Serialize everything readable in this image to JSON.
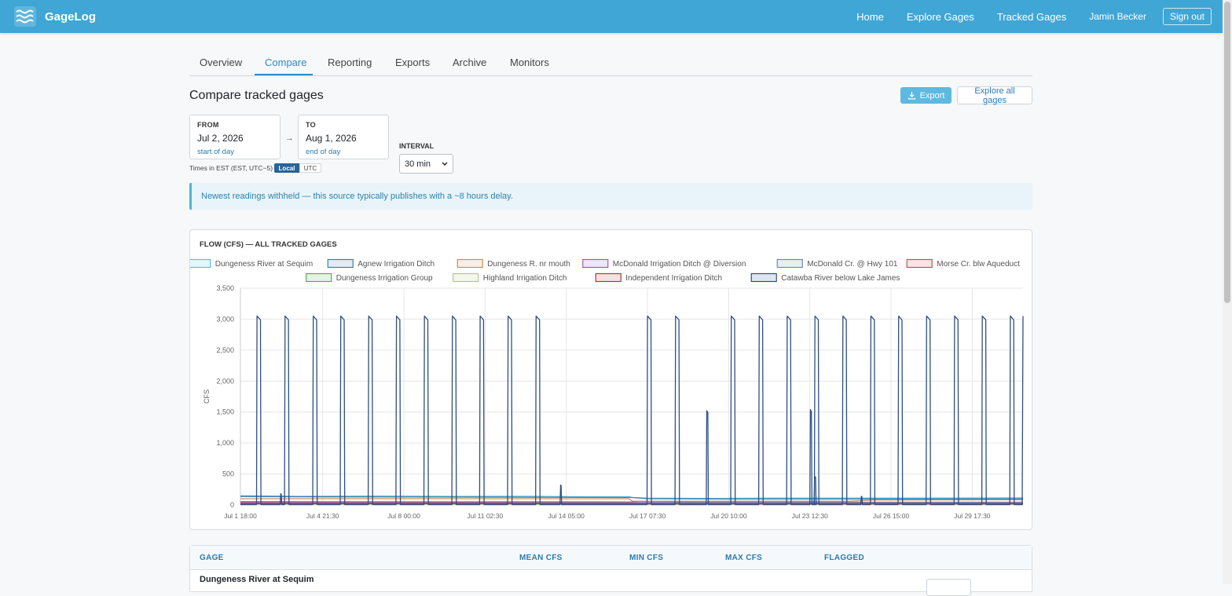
{
  "app": {
    "brand": "GageLog"
  },
  "nav": {
    "home": "Home",
    "explore": "Explore Gages",
    "tracked": "Tracked Gages",
    "user": "Jamin Becker",
    "signout": "Sign out"
  },
  "tabs": [
    {
      "label": "Overview"
    },
    {
      "label": "Compare"
    },
    {
      "label": "Reporting"
    },
    {
      "label": "Exports"
    },
    {
      "label": "Archive"
    },
    {
      "label": "Monitors"
    }
  ],
  "page": {
    "title": "Compare tracked gages",
    "export_label": "Export",
    "explore_all_label": "Explore all gages"
  },
  "range": {
    "from_label": "FROM",
    "from_value": "Jul 2, 2026",
    "from_sub": "start of day",
    "arrow": "→",
    "to_label": "TO",
    "to_value": "Aug 1, 2026",
    "to_sub": "end of day"
  },
  "interval": {
    "label": "INTERVAL",
    "value": "30 min"
  },
  "timezone": {
    "text": "Times in EST (EST, UTC−5)",
    "local": "Local",
    "utc": "UTC"
  },
  "notice": "Newest readings withheld — this source typically publishes with a ~8 hours delay.",
  "chart_data": {
    "type": "line",
    "title": "FLOW (CFS) — ALL TRACKED GAGES",
    "ylabel": "CFS",
    "xlabel": "",
    "ylim": [
      0,
      3500
    ],
    "xlim_days": [
      1.75,
      31.67
    ],
    "yticks": [
      0,
      500,
      1000,
      1500,
      2000,
      2500,
      3000,
      3500
    ],
    "ytick_labels": [
      "0",
      "500",
      "1,000",
      "1,500",
      "2,000",
      "2,500",
      "3,000",
      "3,500"
    ],
    "xtick_labels": [
      "Jul 1 18:00",
      "Jul 4 21:30",
      "Jul 8 00:00",
      "Jul 11 02:30",
      "Jul 14 05:00",
      "Jul 17 07:30",
      "Jul 20 10:00",
      "Jul 23 12:30",
      "Jul 26 15:00",
      "Jul 29 17:30"
    ],
    "xtick_days": [
      1.75,
      4.896,
      8.0,
      11.104,
      14.208,
      17.313,
      20.417,
      23.521,
      26.625,
      29.729
    ],
    "grid": true,
    "legend_position": "top",
    "series": [
      {
        "name": "Dungeness River at Sequim",
        "color": "#5cbfe8",
        "points": [
          [
            1.75,
            150
          ],
          [
            4,
            140
          ],
          [
            7,
            145
          ],
          [
            10,
            138
          ],
          [
            13,
            140
          ],
          [
            15,
            130
          ],
          [
            16.6,
            130
          ],
          [
            16.75,
            120
          ],
          [
            17.3,
            110
          ],
          [
            20,
            105
          ],
          [
            22,
            110
          ],
          [
            25,
            110
          ],
          [
            28,
            110
          ],
          [
            31.67,
            115
          ]
        ]
      },
      {
        "name": "Agnew Irrigation Ditch",
        "color": "#3f7fa8",
        "points": [
          [
            1.75,
            135
          ],
          [
            5,
            130
          ],
          [
            8,
            128
          ],
          [
            12,
            125
          ],
          [
            16.7,
            120
          ],
          [
            17.3,
            100
          ],
          [
            20,
            95
          ],
          [
            25,
            95
          ],
          [
            31.67,
            98
          ]
        ]
      },
      {
        "name": "Dungeness R. nr mouth",
        "color": "#c7905e",
        "points": [
          [
            1.75,
            100
          ],
          [
            5,
            100
          ],
          [
            10,
            100
          ],
          [
            16.6,
            100
          ],
          [
            16.75,
            60
          ],
          [
            20,
            60
          ],
          [
            25,
            60
          ],
          [
            26,
            80
          ],
          [
            31.67,
            82
          ]
        ]
      },
      {
        "name": "McDonald Irrigation Ditch @ Diversion",
        "color": "#9a5bc0",
        "points": [
          [
            1.75,
            40
          ],
          [
            10,
            40
          ],
          [
            16.7,
            38
          ],
          [
            17,
            30
          ],
          [
            25,
            30
          ],
          [
            31.67,
            30
          ]
        ]
      },
      {
        "name": "McDonald Cr. @ Hwy 101",
        "color": "#6e8ea8",
        "points": [
          [
            1.75,
            55
          ],
          [
            10,
            52
          ],
          [
            16.7,
            50
          ],
          [
            20,
            45
          ],
          [
            31.67,
            45
          ]
        ]
      },
      {
        "name": "Morse Cr. blw Aqueduct",
        "color": "#c0505e",
        "points": [
          [
            1.75,
            30
          ],
          [
            10,
            30
          ],
          [
            16.7,
            28
          ],
          [
            17,
            20
          ],
          [
            25,
            22
          ],
          [
            31.67,
            20
          ]
        ]
      },
      {
        "name": "Dungeness Irrigation Group",
        "color": "#5fa85a",
        "points": [
          [
            1.75,
            12
          ],
          [
            10,
            12
          ],
          [
            20,
            10
          ],
          [
            31.67,
            10
          ]
        ]
      },
      {
        "name": "Highland Irrigation Ditch",
        "color": "#b6c78a",
        "points": [
          [
            1.75,
            8
          ],
          [
            15,
            8
          ],
          [
            31.67,
            8
          ]
        ]
      },
      {
        "name": "Independent Irrigation Ditch",
        "color": "#b03a3a",
        "points": [
          [
            1.75,
            20
          ],
          [
            16.7,
            20
          ],
          [
            17,
            18
          ],
          [
            31.67,
            18
          ]
        ]
      },
      {
        "name": "Catawba River below Lake James",
        "color": "#2d4f85",
        "baseline": 5,
        "spikes_full": [
          2.45,
          3.52,
          4.6,
          5.65,
          6.72,
          7.78,
          8.85,
          9.92,
          10.98,
          12.05,
          13.12,
          17.38,
          18.45,
          20.58,
          21.65,
          22.72,
          23.78,
          24.85,
          25.92,
          26.98,
          28.05,
          29.12,
          30.18,
          31.25
        ],
        "spike_peak": 3050,
        "spike_width_days": 0.17,
        "spikes_small": [
          [
            3.3,
            180
          ],
          [
            14.0,
            320
          ],
          [
            25.5,
            140
          ]
        ],
        "bumps": [
          [
            19.6,
            1520
          ],
          [
            23.56,
            1540
          ],
          [
            23.72,
            460
          ]
        ],
        "end_rise": [
          31.67,
          3050
        ]
      }
    ]
  },
  "table": {
    "headers": [
      "GAGE",
      "MEAN CFS",
      "MIN CFS",
      "MAX CFS",
      "FLAGGED"
    ],
    "rows": [
      {
        "name": "Dungeness River at Sequim"
      }
    ]
  }
}
